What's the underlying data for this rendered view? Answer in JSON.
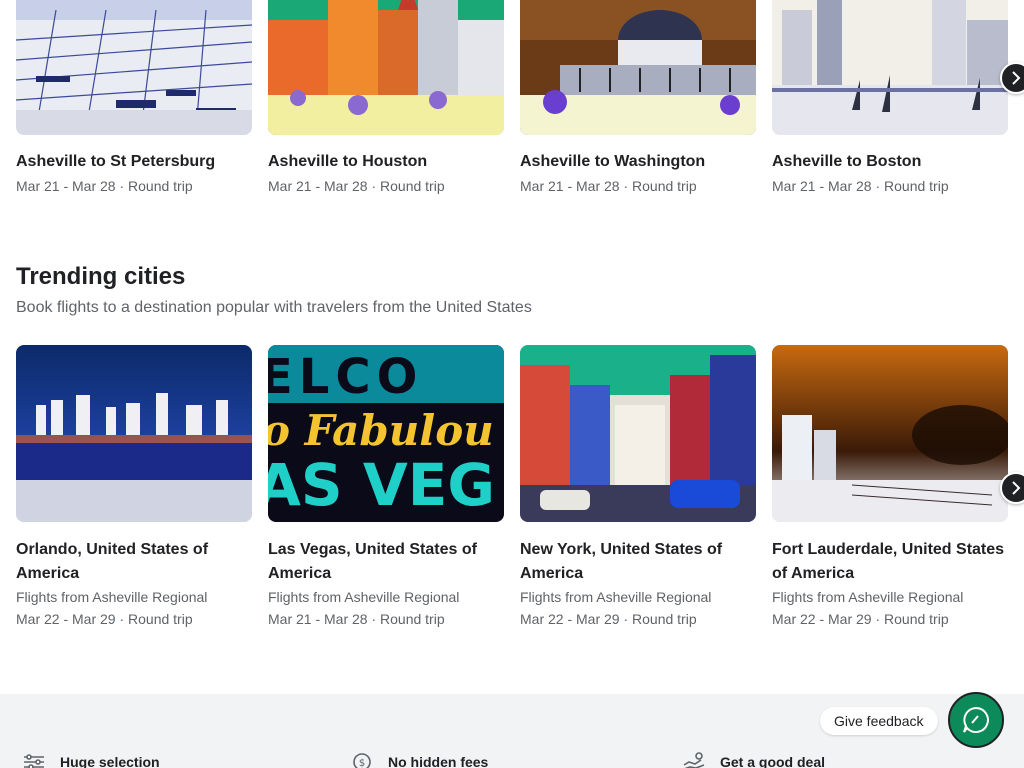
{
  "row1": {
    "cards": [
      {
        "title": "Asheville to St Petersburg",
        "sub": "Mar 21 - Mar 28 · Round trip"
      },
      {
        "title": "Asheville to Houston",
        "sub": "Mar 21 - Mar 28 · Round trip"
      },
      {
        "title": "Asheville to Washington",
        "sub": "Mar 21 - Mar 28 · Round trip"
      },
      {
        "title": "Asheville to Boston",
        "sub": "Mar 21 - Mar 28 · Round trip"
      }
    ]
  },
  "trending": {
    "title": "Trending cities",
    "subtitle": "Book flights to a destination popular with travelers from the United States",
    "cards": [
      {
        "title": "Orlando, United States of America",
        "from": "Flights from Asheville Regional",
        "dates": "Mar 22 - Mar 29 · Round trip"
      },
      {
        "title": "Las Vegas, United States of America",
        "from": "Flights from Asheville Regional",
        "dates": "Mar 21 - Mar 28 · Round trip",
        "sign_text_1": "ELCO",
        "sign_text_2": "o Fabulou",
        "sign_text_3": "AS VEG"
      },
      {
        "title": "New York, United States of America",
        "from": "Flights from Asheville Regional",
        "dates": "Mar 22 - Mar 29 · Round trip"
      },
      {
        "title": "Fort Lauderdale, United States of America",
        "from": "Flights from Asheville Regional",
        "dates": "Mar 22 - Mar 29 · Round trip"
      }
    ]
  },
  "footer": {
    "features": [
      {
        "label": "Huge selection",
        "icon": "selection-icon"
      },
      {
        "label": "No hidden fees",
        "icon": "dollar-icon"
      },
      {
        "label": "Get a good deal",
        "icon": "deal-icon"
      }
    ]
  },
  "feedback": {
    "label": "Give feedback"
  },
  "colors": {
    "accent": "#0d8a5a",
    "nav_button": "#202124",
    "footer_bg": "#f1f3f4"
  }
}
